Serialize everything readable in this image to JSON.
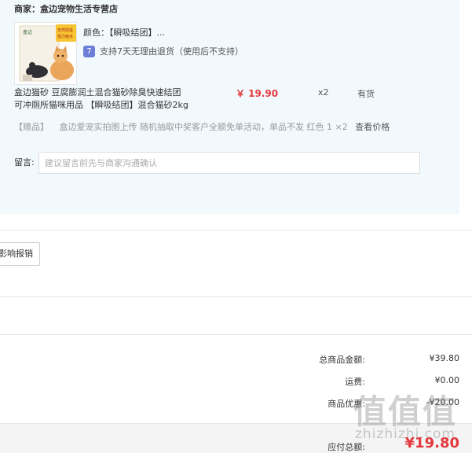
{
  "shop": {
    "label": "商家：",
    "name": "盒边宠物生活专营店"
  },
  "product": {
    "image_icon": "cat-litter-product-image",
    "image_text": {
      "brand": "盒边",
      "badge_line1": "天然抑臭",
      "badge_line2": "强力吸水"
    },
    "spec_label": "颜色：",
    "spec_value": "【瞬吸结团】...",
    "return_icon": "return-policy-icon",
    "return_icon_glyph": "7",
    "return_text": "支持7天无理由退货（使用后不支持）",
    "title_line1": "盒边猫砂 豆腐膨润土混合猫砂除臭快速结团",
    "title_line2": "可冲厕所猫咪用品 【瞬吸结团】混合猫砂2kg",
    "price": "￥ 19.90",
    "quantity": "x2",
    "stock": "有货"
  },
  "gift": {
    "tag": "【赠品】",
    "desc": "盒边爱宠实拍图上传 随机抽取中奖客户全额免单活动，单品不发 红色 1 ×2",
    "link": "查看价格"
  },
  "note": {
    "label": "留言:",
    "placeholder": "建议留言前先与商家沟通确认"
  },
  "reimburse_button": "影响报销",
  "summary": {
    "goods_total_label": "总商品金额:",
    "goods_total_value": "¥39.80",
    "shipping_label": "运费:",
    "shipping_value": "¥0.00",
    "discount_label": "商品优惠:",
    "discount_value": "-¥20.00"
  },
  "total": {
    "label": "应付总额:",
    "value": "¥19.80"
  },
  "watermark": {
    "glyphs": "值值值",
    "text": "zhizhizhi.com",
    "icon": "site-watermark-logo"
  },
  "colors": {
    "price_red": "#e4393c",
    "panel_bg": "#f2f9fd",
    "return_icon_bg": "#6c7fd8"
  }
}
